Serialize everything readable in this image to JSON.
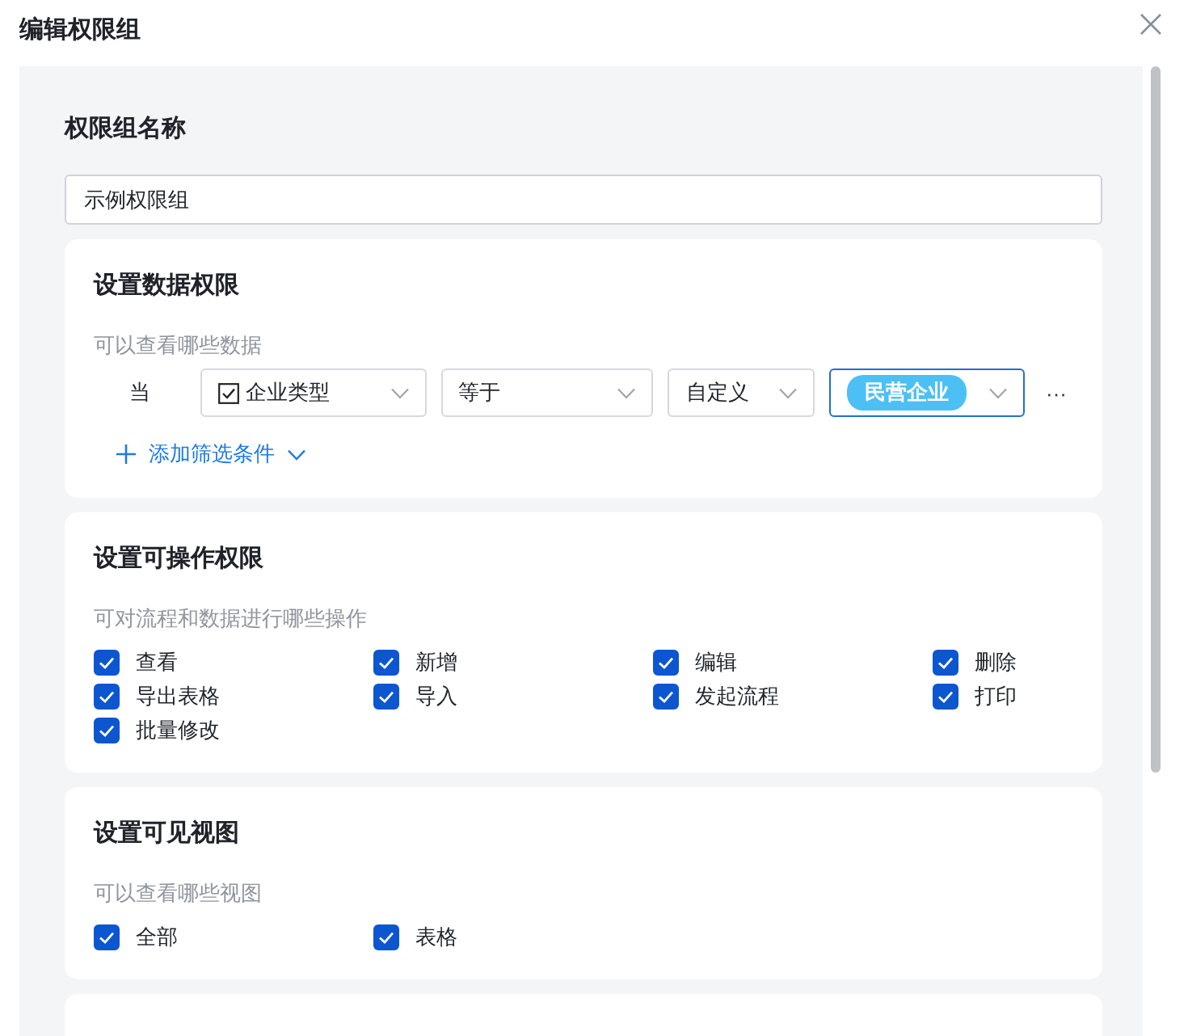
{
  "dialog": {
    "title": "编辑权限组"
  },
  "name_field": {
    "label": "权限组名称",
    "value": "示例权限组"
  },
  "sections": [
    {
      "kind": "filter",
      "title": "设置数据权限",
      "subtitle": "可以查看哪些数据",
      "condition": "当",
      "selects": [
        {
          "kind": "field",
          "text": "企业类型",
          "active": false
        },
        {
          "kind": "text",
          "text": "等于",
          "active": false
        },
        {
          "kind": "text",
          "text": "自定义",
          "active": false
        },
        {
          "kind": "tag",
          "text": "民营企业",
          "active": true
        }
      ],
      "more": "···",
      "add_label": "添加筛选条件"
    },
    {
      "kind": "checks",
      "title": "设置可操作权限",
      "subtitle": "可对流程和数据进行哪些操作",
      "options": [
        {
          "label": "查看",
          "checked": true
        },
        {
          "label": "新增",
          "checked": true
        },
        {
          "label": "编辑",
          "checked": true
        },
        {
          "label": "删除",
          "checked": true
        },
        {
          "label": "导出表格",
          "checked": true
        },
        {
          "label": "导入",
          "checked": true
        },
        {
          "label": "发起流程",
          "checked": true
        },
        {
          "label": "打印",
          "checked": true
        },
        {
          "label": "批量修改",
          "checked": true
        }
      ]
    },
    {
      "kind": "checks",
      "title": "设置可见视图",
      "subtitle": "可以查看哪些视图",
      "options": [
        {
          "label": "全部",
          "checked": true
        },
        {
          "label": "表格",
          "checked": true
        }
      ]
    }
  ]
}
